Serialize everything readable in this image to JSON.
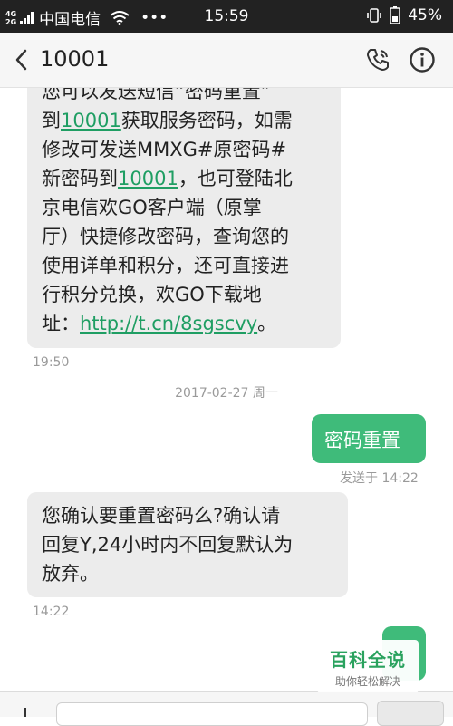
{
  "status_bar": {
    "network_top": "4G",
    "network_bottom": "2G",
    "carrier": "中国电信",
    "more": "•••",
    "time": "15:59",
    "battery": "45%"
  },
  "header": {
    "title": "10001",
    "icons": [
      "back-arrow-icon",
      "call-icon",
      "info-icon"
    ]
  },
  "messages": {
    "m1": {
      "lines": [
        [
          "您可以发送短信“密码重置”"
        ],
        [
          "到",
          {
            "link": "10001"
          },
          "获取服务密码，如需"
        ],
        [
          "修改可发送MMXG#原密码#"
        ],
        [
          "新密码到",
          {
            "link": "10001"
          },
          "，也可登陆北"
        ],
        [
          "京电信欢GO客户端（原掌"
        ],
        [
          "厅）快捷修改密码，查询您的"
        ],
        [
          "使用详单和积分，还可直接进"
        ],
        [
          "行积分兑换，欢GO下载地"
        ],
        [
          "址：",
          {
            "link": "http://t.cn/8sgscvy"
          },
          "。"
        ]
      ],
      "time": "19:50"
    },
    "date_divider": "2017-02-27 周一",
    "m2": {
      "text": "密码重置",
      "status": "发送于 14:22"
    },
    "m3": {
      "lines": [
        [
          "您确认要重置密码么?确认请"
        ],
        [
          "回复Y,24小时内不回复默认为"
        ],
        [
          "放弃。"
        ]
      ],
      "time": "14:22"
    }
  },
  "watermark": {
    "title": "百科全说",
    "subtitle": "助你轻松解决"
  },
  "colors": {
    "status_bar": "#222222",
    "header": "#f6f6f6",
    "incoming_bubble": "#ececec",
    "outgoing_bubble": "#3fbb7a",
    "link": "#1f9e63",
    "meta": "#9a9a9a"
  }
}
